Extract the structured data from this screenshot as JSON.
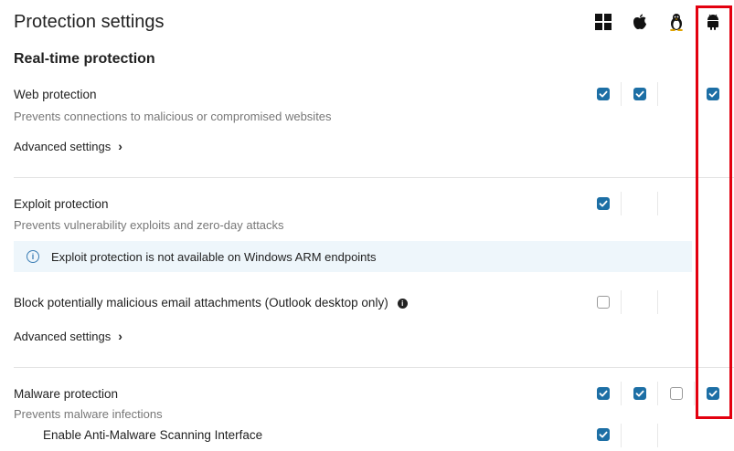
{
  "header": {
    "title": "Protection settings"
  },
  "os_icons": [
    "windows-icon",
    "apple-icon",
    "linux-icon",
    "android-icon"
  ],
  "section": {
    "title": "Real-time protection"
  },
  "web": {
    "label": "Web protection",
    "desc": "Prevents connections to malicious or compromised websites",
    "advanced": "Advanced settings",
    "checks": {
      "windows": true,
      "mac": true,
      "linux": null,
      "android": true
    }
  },
  "exploit": {
    "label": "Exploit protection",
    "desc": "Prevents vulnerability exploits and zero-day attacks",
    "info": "Exploit protection is not available on Windows ARM endpoints",
    "checks": {
      "windows": true,
      "mac": null,
      "linux": null,
      "android": null
    }
  },
  "email": {
    "label": "Block potentially malicious email attachments (Outlook desktop only)",
    "advanced": "Advanced settings",
    "checks": {
      "windows": false,
      "mac": null,
      "linux": null,
      "android": null
    }
  },
  "malware": {
    "label": "Malware protection",
    "desc": "Prevents malware infections",
    "checks": {
      "windows": true,
      "mac": true,
      "linux": false,
      "android": true
    }
  },
  "amsi": {
    "label": "Enable Anti-Malware Scanning Interface",
    "checks": {
      "windows": true,
      "mac": null,
      "linux": null,
      "android": null
    }
  },
  "colors": {
    "accent": "#1d6fa5",
    "highlight": "#e3000f",
    "info_bg": "#eef6fb"
  }
}
